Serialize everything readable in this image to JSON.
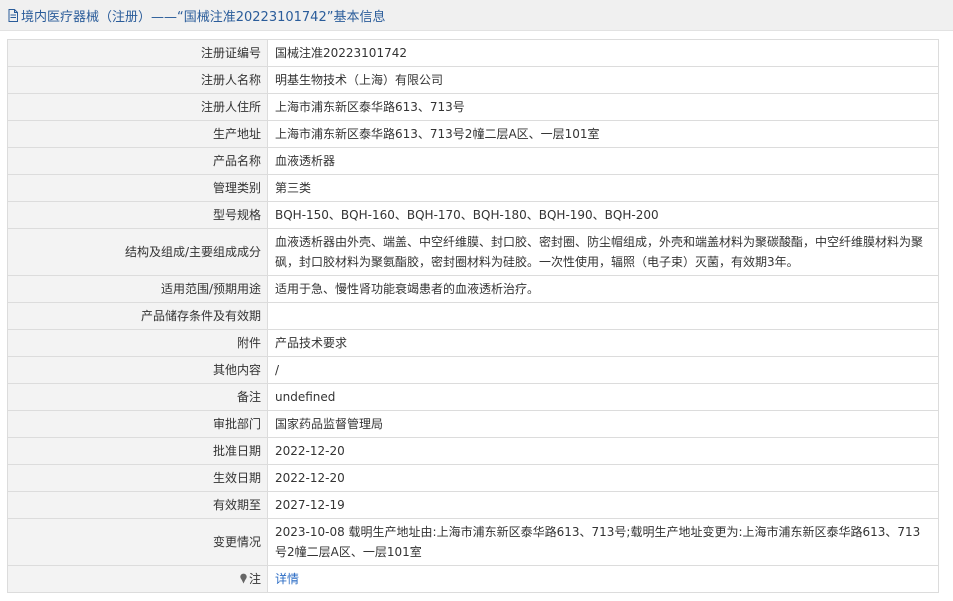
{
  "header": {
    "title": "境内医疗器械（注册）——“国械注准20223101742”基本信息"
  },
  "rows": [
    {
      "label": "注册证编号",
      "value": "国械注准20223101742"
    },
    {
      "label": "注册人名称",
      "value": "明基生物技术（上海）有限公司"
    },
    {
      "label": "注册人住所",
      "value": "上海市浦东新区泰华路613、713号"
    },
    {
      "label": "生产地址",
      "value": "上海市浦东新区泰华路613、713号2幢二层A区、一层101室"
    },
    {
      "label": "产品名称",
      "value": "血液透析器"
    },
    {
      "label": "管理类别",
      "value": "第三类"
    },
    {
      "label": "型号规格",
      "value": "BQH-150、BQH-160、BQH-170、BQH-180、BQH-190、BQH-200"
    },
    {
      "label": "结构及组成/主要组成成分",
      "value": "血液透析器由外壳、端盖、中空纤维膜、封口胶、密封圈、防尘帽组成，外壳和端盖材料为聚碳酸酯，中空纤维膜材料为聚砜，封口胶材料为聚氨酯胶，密封圈材料为硅胶。一次性使用，辐照（电子束）灭菌，有效期3年。"
    },
    {
      "label": "适用范围/预期用途",
      "value": "适用于急、慢性肾功能衰竭患者的血液透析治疗。"
    },
    {
      "label": "产品储存条件及有效期",
      "value": ""
    },
    {
      "label": "附件",
      "value": "产品技术要求"
    },
    {
      "label": "其他内容",
      "value": "/"
    },
    {
      "label": "备注",
      "value": "undefined"
    },
    {
      "label": "审批部门",
      "value": "国家药品监督管理局"
    },
    {
      "label": "批准日期",
      "value": "2022-12-20"
    },
    {
      "label": "生效日期",
      "value": "2022-12-20"
    },
    {
      "label": "有效期至",
      "value": "2027-12-19"
    },
    {
      "label": "变更情况",
      "value": "2023-10-08 载明生产地址由:上海市浦东新区泰华路613、713号;载明生产地址变更为:上海市浦东新区泰华路613、713号2幢二层A区、一层101室"
    }
  ],
  "note": {
    "label": "注",
    "link_text": "详情"
  }
}
